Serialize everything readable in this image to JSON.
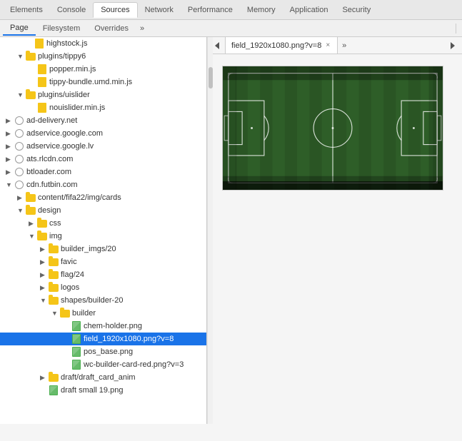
{
  "topTabs": [
    {
      "label": "Elements",
      "active": false
    },
    {
      "label": "Console",
      "active": false
    },
    {
      "label": "Sources",
      "active": true
    },
    {
      "label": "Network",
      "active": false
    },
    {
      "label": "Performance",
      "active": false
    },
    {
      "label": "Memory",
      "active": false
    },
    {
      "label": "Application",
      "active": false
    },
    {
      "label": "Security",
      "active": false
    }
  ],
  "subTabs": [
    {
      "label": "Page",
      "active": true
    },
    {
      "label": "Filesystem",
      "active": false
    },
    {
      "label": "Overrides",
      "active": false
    }
  ],
  "fileTab": {
    "name": "field_1920x1080.png?v=8",
    "closeLabel": "×"
  },
  "treeItems": [
    {
      "id": 1,
      "indent": 32,
      "type": "file-js",
      "label": "highstock.js",
      "expanded": false,
      "hasArrow": false
    },
    {
      "id": 2,
      "indent": 20,
      "type": "folder",
      "label": "plugins/tippy6",
      "expanded": true,
      "hasArrow": true,
      "arrowDown": true
    },
    {
      "id": 3,
      "indent": 36,
      "type": "file-js",
      "label": "popper.min.js",
      "expanded": false,
      "hasArrow": false
    },
    {
      "id": 4,
      "indent": 36,
      "type": "file-js",
      "label": "tippy-bundle.umd.min.js",
      "expanded": false,
      "hasArrow": false
    },
    {
      "id": 5,
      "indent": 20,
      "type": "folder",
      "label": "plugins/uislider",
      "expanded": true,
      "hasArrow": true,
      "arrowDown": true
    },
    {
      "id": 6,
      "indent": 36,
      "type": "file-js",
      "label": "nouislider.min.js",
      "expanded": false,
      "hasArrow": false
    },
    {
      "id": 7,
      "indent": 4,
      "type": "domain",
      "label": "ad-delivery.net",
      "expanded": false,
      "hasArrow": true,
      "arrowDown": false
    },
    {
      "id": 8,
      "indent": 4,
      "type": "domain",
      "label": "adservice.google.com",
      "expanded": false,
      "hasArrow": true,
      "arrowDown": false
    },
    {
      "id": 9,
      "indent": 4,
      "type": "domain",
      "label": "adservice.google.lv",
      "expanded": false,
      "hasArrow": true,
      "arrowDown": false
    },
    {
      "id": 10,
      "indent": 4,
      "type": "domain",
      "label": "ats.rlcdn.com",
      "expanded": false,
      "hasArrow": true,
      "arrowDown": false
    },
    {
      "id": 11,
      "indent": 4,
      "type": "domain",
      "label": "btloader.com",
      "expanded": false,
      "hasArrow": true,
      "arrowDown": false
    },
    {
      "id": 12,
      "indent": 4,
      "type": "domain",
      "label": "cdn.futbin.com",
      "expanded": true,
      "hasArrow": true,
      "arrowDown": true
    },
    {
      "id": 13,
      "indent": 20,
      "type": "folder",
      "label": "content/fifa22/img/cards",
      "expanded": false,
      "hasArrow": true,
      "arrowDown": false
    },
    {
      "id": 14,
      "indent": 20,
      "type": "folder",
      "label": "design",
      "expanded": true,
      "hasArrow": true,
      "arrowDown": true
    },
    {
      "id": 15,
      "indent": 36,
      "type": "folder",
      "label": "css",
      "expanded": false,
      "hasArrow": true,
      "arrowDown": false
    },
    {
      "id": 16,
      "indent": 36,
      "type": "folder",
      "label": "img",
      "expanded": true,
      "hasArrow": true,
      "arrowDown": true
    },
    {
      "id": 17,
      "indent": 52,
      "type": "folder",
      "label": "builder_imgs/20",
      "expanded": false,
      "hasArrow": true,
      "arrowDown": false
    },
    {
      "id": 18,
      "indent": 52,
      "type": "folder",
      "label": "favic",
      "expanded": false,
      "hasArrow": true,
      "arrowDown": false
    },
    {
      "id": 19,
      "indent": 52,
      "type": "folder",
      "label": "flag/24",
      "expanded": false,
      "hasArrow": true,
      "arrowDown": false
    },
    {
      "id": 20,
      "indent": 52,
      "type": "folder",
      "label": "logos",
      "expanded": false,
      "hasArrow": true,
      "arrowDown": false
    },
    {
      "id": 21,
      "indent": 52,
      "type": "folder",
      "label": "shapes/builder-20",
      "expanded": true,
      "hasArrow": true,
      "arrowDown": true
    },
    {
      "id": 22,
      "indent": 68,
      "type": "folder",
      "label": "builder",
      "expanded": true,
      "hasArrow": true,
      "arrowDown": true
    },
    {
      "id": 23,
      "indent": 84,
      "type": "file-img",
      "label": "chem-holder.png",
      "expanded": false,
      "hasArrow": false
    },
    {
      "id": 24,
      "indent": 84,
      "type": "file-img",
      "label": "field_1920x1080.png?v=8",
      "expanded": false,
      "hasArrow": false,
      "selected": true
    },
    {
      "id": 25,
      "indent": 84,
      "type": "file-img",
      "label": "pos_base.png",
      "expanded": false,
      "hasArrow": false
    },
    {
      "id": 26,
      "indent": 84,
      "type": "file-img",
      "label": "wc-builder-card-red.png?v=3",
      "expanded": false,
      "hasArrow": false
    },
    {
      "id": 27,
      "indent": 52,
      "type": "folder",
      "label": "draft/draft_card_anim",
      "expanded": false,
      "hasArrow": true,
      "arrowDown": false
    },
    {
      "id": 28,
      "indent": 52,
      "type": "folder",
      "label": "draft small 19.png",
      "expanded": false,
      "hasArrow": false
    }
  ],
  "preview": {
    "altText": "Soccer field preview"
  }
}
